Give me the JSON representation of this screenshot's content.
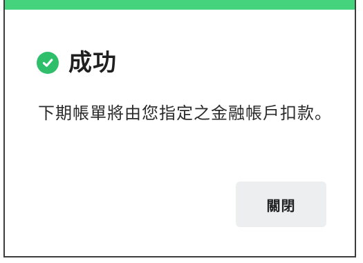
{
  "dialog": {
    "title": "成功",
    "message": "下期帳單將由您指定之金融帳戶扣款。",
    "close_label": "關閉",
    "status_icon": "check-circle-icon"
  },
  "colors": {
    "accent": "#46d37d",
    "success": "#2fbf6b",
    "button_bg": "#eceef0",
    "text": "#1f1f1f"
  }
}
